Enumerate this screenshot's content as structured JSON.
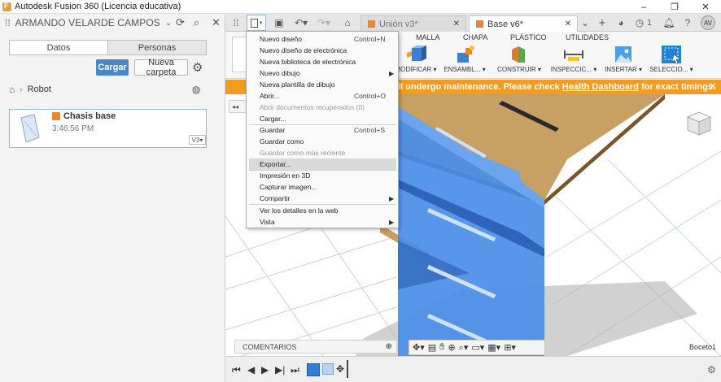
{
  "window": {
    "title": "Autodesk Fusion 360 (Licencia educativa)",
    "controls": [
      "–",
      "❐",
      "✕"
    ]
  },
  "data_panel": {
    "user": "ARMANDO VELARDE CAMPOS",
    "tabs": [
      {
        "label": "Datos",
        "active": true
      },
      {
        "label": "Personas",
        "active": false
      }
    ],
    "upload_label": "Cargar",
    "new_folder_label": "Nueva carpeta",
    "breadcrumb": "Robot",
    "file": {
      "name": "Chasis base",
      "time": "3:46:56 PM",
      "version": "V3▾"
    }
  },
  "appbar": {
    "doc_tabs": [
      {
        "label": "Unión v3*",
        "active": false
      },
      {
        "label": "Base v6*",
        "active": true
      }
    ],
    "job_count": "1",
    "avatar": "AV"
  },
  "ribbon": {
    "tabs": [
      "MALLA",
      "CHAPA",
      "PLÁSTICO",
      "UTILIDADES"
    ],
    "tools": [
      {
        "label": "MODIFICAR ▾"
      },
      {
        "label": "ENSAMBL... ▾"
      },
      {
        "label": "CONSTRUIR ▾"
      },
      {
        "label": "INSPECCIC... ▾"
      },
      {
        "label": "INSERTAR ▾"
      },
      {
        "label": "SELECCIO... ▾"
      }
    ]
  },
  "banner": {
    "text_before": "ll undergo maintenance. Please check ",
    "link": "Health Dashboard",
    "text_after": " for exact timings.",
    "close": "✕"
  },
  "canvas": {
    "comments_label": "COMENTARIOS",
    "sketch_label": "Boceto1"
  },
  "file_menu": {
    "items": [
      {
        "label": "Nuevo diseño",
        "shortcut": "Control+N",
        "disabled": false
      },
      {
        "label": "Nuevo diseño de electrónica",
        "shortcut": "",
        "disabled": false
      },
      {
        "label": "Nueva biblioteca de electrónica",
        "shortcut": "",
        "disabled": false
      },
      {
        "label": "Nuevo dibujo",
        "shortcut": "",
        "disabled": false,
        "submenu": true
      },
      {
        "label": "Nueva plantilla de dibujo",
        "shortcut": "",
        "disabled": false
      },
      {
        "label": "Abrir...",
        "shortcut": "Control+O",
        "disabled": false
      },
      {
        "label": "Abrir documentos recuperados (0)",
        "shortcut": "",
        "disabled": true
      },
      {
        "label": "Cargar...",
        "shortcut": "",
        "disabled": false
      },
      {
        "label": "Guardar",
        "shortcut": "Control+S",
        "disabled": false
      },
      {
        "label": "Guardar como",
        "shortcut": "",
        "disabled": false
      },
      {
        "label": "Guardar como más reciente",
        "shortcut": "",
        "disabled": true
      },
      {
        "label": "Exportar...",
        "shortcut": "",
        "disabled": false,
        "hover": true
      },
      {
        "label": "Impresión en 3D",
        "shortcut": "",
        "disabled": false
      },
      {
        "label": "Capturar imagen...",
        "shortcut": "",
        "disabled": false
      },
      {
        "label": "Compartir",
        "shortcut": "",
        "disabled": false,
        "submenu": true
      },
      {
        "label": "Ver los detalles en la web",
        "shortcut": "",
        "disabled": false
      },
      {
        "label": "Vista",
        "shortcut": "",
        "disabled": false,
        "submenu": true
      }
    ]
  },
  "colors": {
    "accent": "#4b87c8",
    "banner": "#f39c1f",
    "body_blue": "#4a8de8",
    "wood": "#c9a063"
  }
}
